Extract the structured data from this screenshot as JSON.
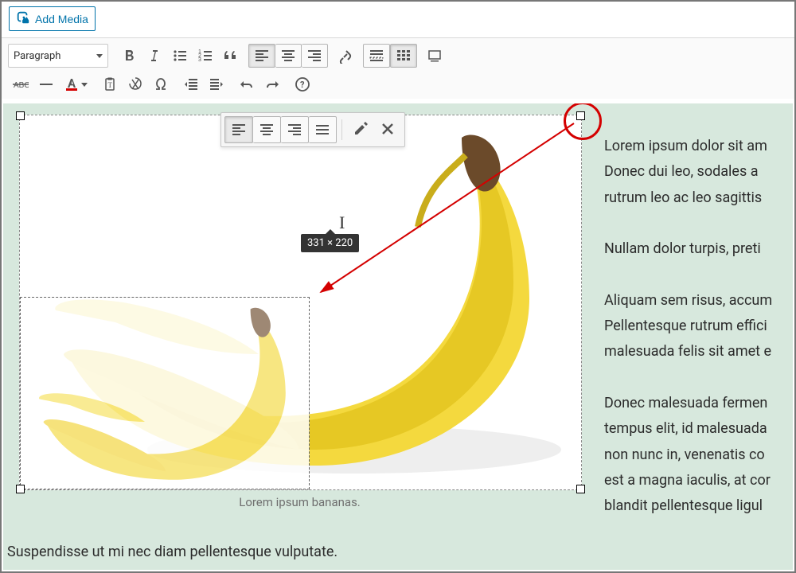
{
  "add_media_label": "Add Media",
  "format_select": "Paragraph",
  "toolbar_row1": [
    {
      "name": "bold-button",
      "icon": "bold"
    },
    {
      "name": "italic-button",
      "icon": "italic"
    },
    {
      "name": "ul-button",
      "icon": "ul"
    },
    {
      "name": "ol-button",
      "icon": "ol"
    },
    {
      "name": "blockquote-button",
      "icon": "quote"
    }
  ],
  "align_group": [
    {
      "name": "align-left-button",
      "icon": "alignl",
      "active": true
    },
    {
      "name": "align-center-button",
      "icon": "alignc"
    },
    {
      "name": "align-right-button",
      "icon": "alignr"
    }
  ],
  "toolbar_row1b": [
    {
      "name": "link-button",
      "icon": "link"
    },
    {
      "name": "more-button",
      "icon": "more"
    },
    {
      "name": "toggle-toolbar-button",
      "icon": "kitchensink",
      "active": true
    },
    {
      "name": "distraction-free-button",
      "icon": "dfw"
    }
  ],
  "toolbar_row2": [
    {
      "name": "strike-button",
      "icon": "strike"
    },
    {
      "name": "hr-button",
      "icon": "hr"
    },
    {
      "name": "textcolor-button",
      "icon": "textcolor",
      "dropdown": true
    },
    {
      "name": "paste-button",
      "icon": "paste"
    },
    {
      "name": "clear-format-button",
      "icon": "clear"
    },
    {
      "name": "special-char-button",
      "icon": "omega"
    },
    {
      "name": "outdent-button",
      "icon": "outdent"
    },
    {
      "name": "indent-button",
      "icon": "indent"
    },
    {
      "name": "undo-button",
      "icon": "undo"
    },
    {
      "name": "redo-button",
      "icon": "redo"
    },
    {
      "name": "help-button",
      "icon": "help"
    }
  ],
  "image_float_toolbar": [
    {
      "name": "img-align-left",
      "icon": "alignl",
      "active": true
    },
    {
      "name": "img-align-center",
      "icon": "alignc"
    },
    {
      "name": "img-align-right",
      "icon": "alignr"
    },
    {
      "name": "img-align-none",
      "icon": "alignn"
    }
  ],
  "image_float_toolbar_right": [
    {
      "name": "img-edit",
      "icon": "pencil"
    },
    {
      "name": "img-remove",
      "icon": "x"
    }
  ],
  "resize_tooltip": "331 × 220",
  "caption": "Lorem ipsum bananas.",
  "paragraphs": [
    "Lorem ipsum dolor sit amet, consectetur. Donec dui leo, sodales a rutrum leo ac leo sagittis",
    "Nullam dolor turpis, preti",
    "Aliquam sem risus, accumsan Pellentesque rutrum efficitur malesuada felis sit amet",
    "Donec malesuada fermentum tempus elit, id malesuada non nunc in, venenatis consequat est a magna iaculis, at congue blandit pellentesque ligula"
  ],
  "para1_line1": "Lorem ipsum dolor sit am",
  "para1_line2": "Donec dui leo, sodales a",
  "para1_line3": "rutrum leo ac leo sagittis",
  "para2_line1": "Nullam dolor turpis, preti",
  "para3_line1": "Aliquam sem risus, accum",
  "para3_line2": "Pellentesque rutrum effici",
  "para3_line3": "malesuada felis sit amet e",
  "para4_line1": "Donec malesuada fermen",
  "para4_line2": "tempus elit, id malesuada",
  "para4_line3": "non nunc in, venenatis co",
  "para4_line4": "est a magna iaculis, at cor",
  "para4_line5": "blandit pellentesque ligul",
  "last_paragraph": "Suspendisse ut mi nec diam pellentesque vulputate."
}
